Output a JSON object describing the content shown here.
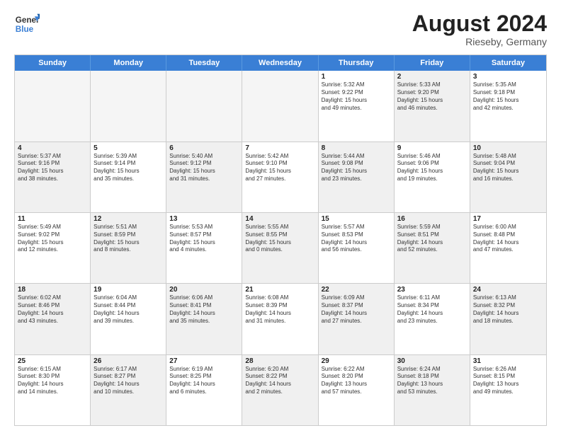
{
  "header": {
    "logo_line1": "General",
    "logo_line2": "Blue",
    "main_title": "August 2024",
    "subtitle": "Rieseby, Germany"
  },
  "days_of_week": [
    "Sunday",
    "Monday",
    "Tuesday",
    "Wednesday",
    "Thursday",
    "Friday",
    "Saturday"
  ],
  "rows": [
    [
      {
        "day": "",
        "info": "",
        "empty": true
      },
      {
        "day": "",
        "info": "",
        "empty": true
      },
      {
        "day": "",
        "info": "",
        "empty": true
      },
      {
        "day": "",
        "info": "",
        "empty": true
      },
      {
        "day": "1",
        "info": "Sunrise: 5:32 AM\nSunset: 9:22 PM\nDaylight: 15 hours\nand 49 minutes.",
        "empty": false,
        "shaded": false
      },
      {
        "day": "2",
        "info": "Sunrise: 5:33 AM\nSunset: 9:20 PM\nDaylight: 15 hours\nand 46 minutes.",
        "empty": false,
        "shaded": true
      },
      {
        "day": "3",
        "info": "Sunrise: 5:35 AM\nSunset: 9:18 PM\nDaylight: 15 hours\nand 42 minutes.",
        "empty": false,
        "shaded": false
      }
    ],
    [
      {
        "day": "4",
        "info": "Sunrise: 5:37 AM\nSunset: 9:16 PM\nDaylight: 15 hours\nand 38 minutes.",
        "empty": false,
        "shaded": true
      },
      {
        "day": "5",
        "info": "Sunrise: 5:39 AM\nSunset: 9:14 PM\nDaylight: 15 hours\nand 35 minutes.",
        "empty": false,
        "shaded": false
      },
      {
        "day": "6",
        "info": "Sunrise: 5:40 AM\nSunset: 9:12 PM\nDaylight: 15 hours\nand 31 minutes.",
        "empty": false,
        "shaded": true
      },
      {
        "day": "7",
        "info": "Sunrise: 5:42 AM\nSunset: 9:10 PM\nDaylight: 15 hours\nand 27 minutes.",
        "empty": false,
        "shaded": false
      },
      {
        "day": "8",
        "info": "Sunrise: 5:44 AM\nSunset: 9:08 PM\nDaylight: 15 hours\nand 23 minutes.",
        "empty": false,
        "shaded": true
      },
      {
        "day": "9",
        "info": "Sunrise: 5:46 AM\nSunset: 9:06 PM\nDaylight: 15 hours\nand 19 minutes.",
        "empty": false,
        "shaded": false
      },
      {
        "day": "10",
        "info": "Sunrise: 5:48 AM\nSunset: 9:04 PM\nDaylight: 15 hours\nand 16 minutes.",
        "empty": false,
        "shaded": true
      }
    ],
    [
      {
        "day": "11",
        "info": "Sunrise: 5:49 AM\nSunset: 9:02 PM\nDaylight: 15 hours\nand 12 minutes.",
        "empty": false,
        "shaded": false
      },
      {
        "day": "12",
        "info": "Sunrise: 5:51 AM\nSunset: 8:59 PM\nDaylight: 15 hours\nand 8 minutes.",
        "empty": false,
        "shaded": true
      },
      {
        "day": "13",
        "info": "Sunrise: 5:53 AM\nSunset: 8:57 PM\nDaylight: 15 hours\nand 4 minutes.",
        "empty": false,
        "shaded": false
      },
      {
        "day": "14",
        "info": "Sunrise: 5:55 AM\nSunset: 8:55 PM\nDaylight: 15 hours\nand 0 minutes.",
        "empty": false,
        "shaded": true
      },
      {
        "day": "15",
        "info": "Sunrise: 5:57 AM\nSunset: 8:53 PM\nDaylight: 14 hours\nand 56 minutes.",
        "empty": false,
        "shaded": false
      },
      {
        "day": "16",
        "info": "Sunrise: 5:59 AM\nSunset: 8:51 PM\nDaylight: 14 hours\nand 52 minutes.",
        "empty": false,
        "shaded": true
      },
      {
        "day": "17",
        "info": "Sunrise: 6:00 AM\nSunset: 8:48 PM\nDaylight: 14 hours\nand 47 minutes.",
        "empty": false,
        "shaded": false
      }
    ],
    [
      {
        "day": "18",
        "info": "Sunrise: 6:02 AM\nSunset: 8:46 PM\nDaylight: 14 hours\nand 43 minutes.",
        "empty": false,
        "shaded": true
      },
      {
        "day": "19",
        "info": "Sunrise: 6:04 AM\nSunset: 8:44 PM\nDaylight: 14 hours\nand 39 minutes.",
        "empty": false,
        "shaded": false
      },
      {
        "day": "20",
        "info": "Sunrise: 6:06 AM\nSunset: 8:41 PM\nDaylight: 14 hours\nand 35 minutes.",
        "empty": false,
        "shaded": true
      },
      {
        "day": "21",
        "info": "Sunrise: 6:08 AM\nSunset: 8:39 PM\nDaylight: 14 hours\nand 31 minutes.",
        "empty": false,
        "shaded": false
      },
      {
        "day": "22",
        "info": "Sunrise: 6:09 AM\nSunset: 8:37 PM\nDaylight: 14 hours\nand 27 minutes.",
        "empty": false,
        "shaded": true
      },
      {
        "day": "23",
        "info": "Sunrise: 6:11 AM\nSunset: 8:34 PM\nDaylight: 14 hours\nand 23 minutes.",
        "empty": false,
        "shaded": false
      },
      {
        "day": "24",
        "info": "Sunrise: 6:13 AM\nSunset: 8:32 PM\nDaylight: 14 hours\nand 18 minutes.",
        "empty": false,
        "shaded": true
      }
    ],
    [
      {
        "day": "25",
        "info": "Sunrise: 6:15 AM\nSunset: 8:30 PM\nDaylight: 14 hours\nand 14 minutes.",
        "empty": false,
        "shaded": false
      },
      {
        "day": "26",
        "info": "Sunrise: 6:17 AM\nSunset: 8:27 PM\nDaylight: 14 hours\nand 10 minutes.",
        "empty": false,
        "shaded": true
      },
      {
        "day": "27",
        "info": "Sunrise: 6:19 AM\nSunset: 8:25 PM\nDaylight: 14 hours\nand 6 minutes.",
        "empty": false,
        "shaded": false
      },
      {
        "day": "28",
        "info": "Sunrise: 6:20 AM\nSunset: 8:22 PM\nDaylight: 14 hours\nand 2 minutes.",
        "empty": false,
        "shaded": true
      },
      {
        "day": "29",
        "info": "Sunrise: 6:22 AM\nSunset: 8:20 PM\nDaylight: 13 hours\nand 57 minutes.",
        "empty": false,
        "shaded": false
      },
      {
        "day": "30",
        "info": "Sunrise: 6:24 AM\nSunset: 8:18 PM\nDaylight: 13 hours\nand 53 minutes.",
        "empty": false,
        "shaded": true
      },
      {
        "day": "31",
        "info": "Sunrise: 6:26 AM\nSunset: 8:15 PM\nDaylight: 13 hours\nand 49 minutes.",
        "empty": false,
        "shaded": false
      }
    ]
  ]
}
